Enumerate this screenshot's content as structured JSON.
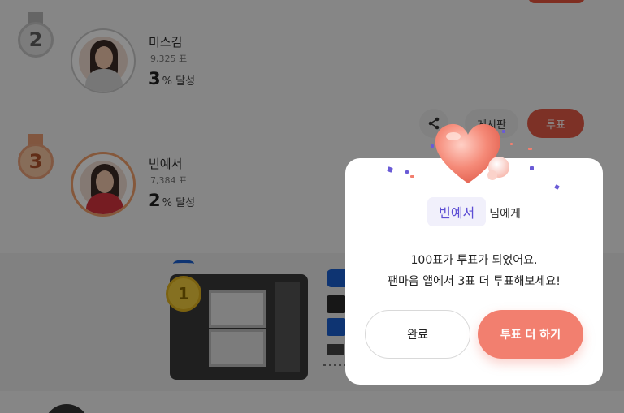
{
  "ranking": [
    {
      "rank": "2",
      "name": "미스김",
      "votes": "9,325 표",
      "percent": "3",
      "achieved_label": "% 달성"
    },
    {
      "rank": "3",
      "name": "빈예서",
      "votes": "7,384 표",
      "percent": "2",
      "achieved_label": "% 달성"
    }
  ],
  "actions": {
    "board_label": "게시판",
    "vote_label": "투표"
  },
  "ad": {
    "medal_rank": "1"
  },
  "modal": {
    "target_name": "빈예서",
    "target_suffix": "님에게",
    "line1": "100표가 투표가 되었어요.",
    "line2": "팬마음 앱에서 3표 더 투표해보세요!",
    "done_label": "완료",
    "more_label": "투표 더 하기"
  },
  "colors": {
    "accent_red": "#e45a46",
    "button_coral": "#f27f6f",
    "name_purple": "#5d4ed4",
    "heart_pink": "#f27f6f"
  },
  "icons": [
    "share-icon",
    "heart-icon"
  ]
}
